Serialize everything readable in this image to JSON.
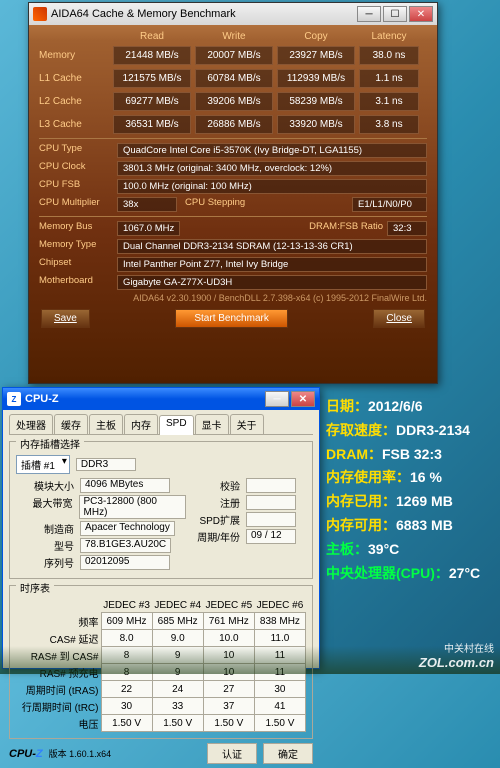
{
  "aida": {
    "title": "AIDA64 Cache & Memory Benchmark",
    "columns": [
      "",
      "Read",
      "Write",
      "Copy",
      "Latency"
    ],
    "rows": [
      {
        "label": "Memory",
        "read": "21448 MB/s",
        "write": "20007 MB/s",
        "copy": "23927 MB/s",
        "latency": "38.0 ns"
      },
      {
        "label": "L1 Cache",
        "read": "121575 MB/s",
        "write": "60784 MB/s",
        "copy": "112939 MB/s",
        "latency": "1.1 ns"
      },
      {
        "label": "L2 Cache",
        "read": "69277 MB/s",
        "write": "39206 MB/s",
        "copy": "58239 MB/s",
        "latency": "3.1 ns"
      },
      {
        "label": "L3 Cache",
        "read": "36531 MB/s",
        "write": "26886 MB/s",
        "copy": "33920 MB/s",
        "latency": "3.8 ns"
      }
    ],
    "cpu_type_label": "CPU Type",
    "cpu_type": "QuadCore Intel Core i5-3570K (Ivy Bridge-DT, LGA1155)",
    "cpu_clock_label": "CPU Clock",
    "cpu_clock": "3801.3 MHz  (original: 3400 MHz, overclock: 12%)",
    "cpu_fsb_label": "CPU FSB",
    "cpu_fsb": "100.0 MHz  (original: 100 MHz)",
    "cpu_mult_label": "CPU Multiplier",
    "cpu_mult": "38x",
    "cpu_stepping_label": "CPU Stepping",
    "cpu_stepping": "E1/L1/N0/P0",
    "mem_bus_label": "Memory Bus",
    "mem_bus": "1067.0 MHz",
    "dram_fsb_label": "DRAM:FSB Ratio",
    "dram_fsb": "32:3",
    "mem_type_label": "Memory Type",
    "mem_type": "Dual Channel DDR3-2134 SDRAM  (12-13-13-36 CR1)",
    "chipset_label": "Chipset",
    "chipset": "Intel Panther Point Z77, Intel Ivy Bridge",
    "mobo_label": "Motherboard",
    "mobo": "Gigabyte GA-Z77X-UD3H",
    "footer": "AIDA64 v2.30.1900 / BenchDLL 2.7.398-x64  (c) 1995-2012 FinalWire Ltd.",
    "save_btn": "Save",
    "start_btn": "Start Benchmark",
    "close_btn": "Close"
  },
  "cpuz": {
    "title": "CPU-Z",
    "tabs": [
      "处理器",
      "缓存",
      "主板",
      "内存",
      "SPD",
      "显卡",
      "关于"
    ],
    "active_tab": 4,
    "slot_section": "内存插槽选择",
    "slot_label": "插槽 #1",
    "slot_type": "DDR3",
    "module_size_label": "模块大小",
    "module_size": "4096 MBytes",
    "bandwidth_label": "最大带宽",
    "bandwidth": "PC3-12800 (800 MHz)",
    "manuf_label": "制造商",
    "manuf": "Apacer Technology",
    "part_label": "型号",
    "part": "78.B1GE3.AU20C",
    "serial_label": "序列号",
    "serial": "02012095",
    "correction_label": "校验",
    "date_label": "注册",
    "spd_ext_label": "SPD扩展",
    "week_label": "周期/年份",
    "week": "09 / 12",
    "timing_section": "时序表",
    "timing_header": [
      "",
      "JEDEC #3",
      "JEDEC #4",
      "JEDEC #5",
      "JEDEC #6"
    ],
    "timing_rows": [
      {
        "label": "频率",
        "v": [
          "609 MHz",
          "685 MHz",
          "761 MHz",
          "838 MHz"
        ]
      },
      {
        "label": "CAS# 延迟",
        "v": [
          "8.0",
          "9.0",
          "10.0",
          "11.0"
        ]
      },
      {
        "label": "RAS# 到 CAS#",
        "v": [
          "8",
          "9",
          "10",
          "11"
        ]
      },
      {
        "label": "RAS# 预充电",
        "v": [
          "8",
          "9",
          "10",
          "11"
        ]
      },
      {
        "label": "周期时间 (tRAS)",
        "v": [
          "22",
          "24",
          "27",
          "30"
        ]
      },
      {
        "label": "行周期时间 (tRC)",
        "v": [
          "30",
          "33",
          "37",
          "41"
        ]
      },
      {
        "label": "电压",
        "v": [
          "1.50 V",
          "1.50 V",
          "1.50 V",
          "1.50 V"
        ]
      }
    ],
    "version_label": "版本",
    "version": "1.60.1.x64",
    "validate_btn": "认证",
    "ok_btn": "确定"
  },
  "overlay": {
    "date_k": "日期：",
    "date_v": "2012/6/6",
    "speed_k": "存取速度：",
    "speed_v": "DDR3-2134",
    "dram_k": "DRAM：",
    "dram_m": "FSB 32:3",
    "usage_k": "内存使用率：",
    "usage_v": "16 %",
    "used_k": "内存已用：",
    "used_v": "1269 MB",
    "avail_k": "内存可用：",
    "avail_v": "6883 MB",
    "mobo_k": "主板：",
    "mobo_v": "39°C",
    "cpu_k": "中央处理器(CPU)：",
    "cpu_v": "27°C"
  },
  "watermark": {
    "line1": "中关村在线",
    "line2": "ZOL.com.cn"
  }
}
